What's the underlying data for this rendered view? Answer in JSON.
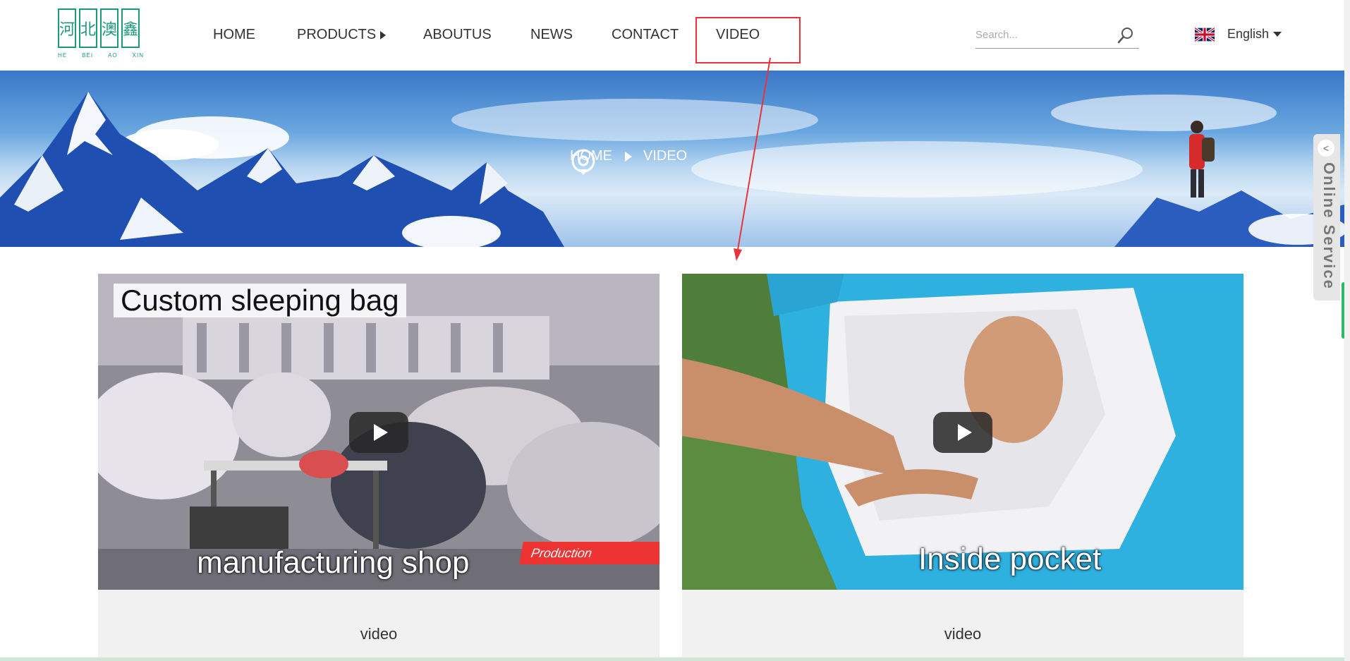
{
  "logo": {
    "chars": [
      "河",
      "北",
      "澳",
      "鑫"
    ],
    "sub": [
      "HE",
      "BEI",
      "AO",
      "XIN"
    ]
  },
  "nav": {
    "home": "HOME",
    "products": "PRODUCTS",
    "about": "ABOUTUS",
    "news": "NEWS",
    "contact": "CONTACT",
    "video": "VIDEO"
  },
  "search": {
    "placeholder": "Search..."
  },
  "language": {
    "label": "English"
  },
  "breadcrumb": {
    "home": "HOME",
    "current": "VIDEO"
  },
  "online_service": {
    "label": "Online Service"
  },
  "videos": [
    {
      "caption_top": "Custom sleeping bag",
      "caption_bottom": "manufacturing shop",
      "tag": "Production",
      "title": "video"
    },
    {
      "caption_bottom": "Inside pocket",
      "title": "video"
    }
  ],
  "colors": {
    "brand_green": "#1a9a7a",
    "annotation_red": "#e8343a"
  },
  "icons": [
    "search-icon",
    "uk-flag-icon",
    "location-pin-icon",
    "play-icon",
    "chevron-left-icon"
  ]
}
